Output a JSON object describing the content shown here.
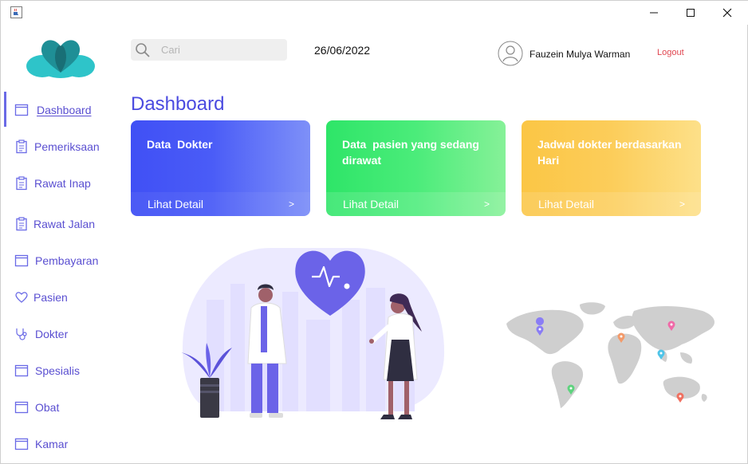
{
  "window": {
    "app_icon": "java-coffee-icon",
    "controls": [
      "minimize-icon",
      "maximize-icon",
      "close-icon"
    ]
  },
  "sidebar": {
    "logo": "heart-cloud-logo",
    "items": [
      {
        "label": "Dashboard",
        "icon": "window-icon",
        "active": true
      },
      {
        "label": "Pemeriksaan",
        "icon": "clipboard-icon"
      },
      {
        "label": "Rawat Inap",
        "icon": "clipboard-icon"
      },
      {
        "label": "Rawat Jalan",
        "icon": "clipboard-icon"
      },
      {
        "label": "Pembayaran",
        "icon": "window-icon"
      },
      {
        "label": "Pasien",
        "icon": "heart-icon"
      },
      {
        "label": "Dokter",
        "icon": "stethoscope-icon"
      },
      {
        "label": "Spesialis",
        "icon": "window-icon"
      },
      {
        "label": "Obat",
        "icon": "window-icon"
      },
      {
        "label": "Kamar",
        "icon": "window-icon"
      }
    ]
  },
  "header": {
    "search_value": "Cari",
    "date": "26/06/2022",
    "username": "Fauzein Mulya Warman",
    "logout": "Logout"
  },
  "main": {
    "title": "Dashboard",
    "cards": [
      {
        "title": "Data  Dokter",
        "link": "Lihat Detail",
        "arrow": ">",
        "color": "#4050f5"
      },
      {
        "title": "Data  pasien yang sedang dirawat",
        "link": "Lihat Detail",
        "arrow": ">",
        "color": "#2ee568"
      },
      {
        "title": "Jadwal dokter berdasarkan Hari",
        "link": "Lihat Detail",
        "arrow": ">",
        "color": "#fbc645"
      }
    ]
  },
  "colors": {
    "accent": "#4a4ae0",
    "logout": "#e0454f",
    "logo_teal": "#2ec4c9"
  }
}
